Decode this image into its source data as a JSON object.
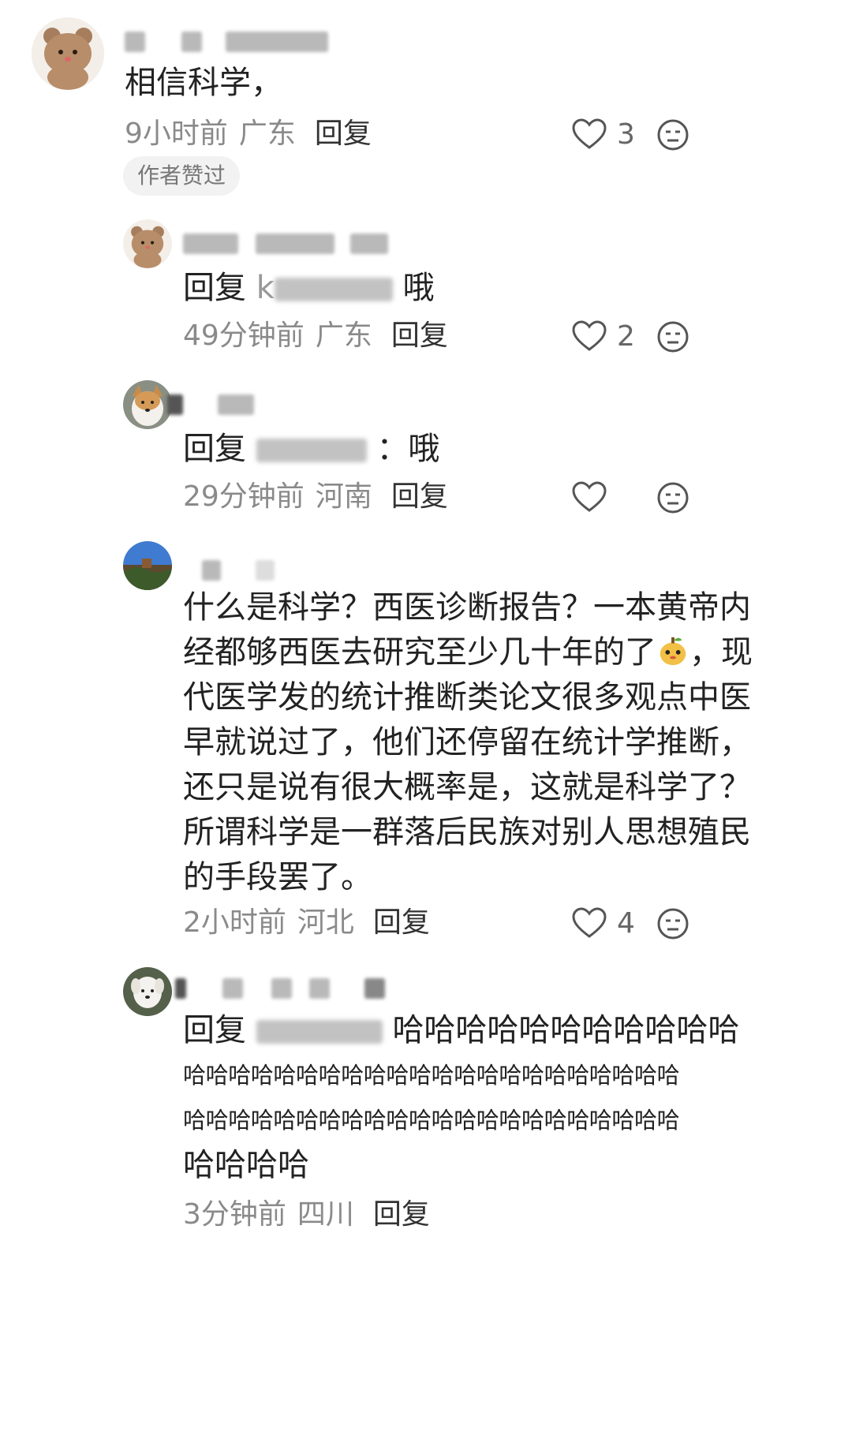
{
  "comments": [
    {
      "avatar": "brown-bear-avatar",
      "text": "相信科学，",
      "time": "9小时前",
      "location": "广东",
      "reply_label": "回复",
      "likes": "3",
      "badge": "作者赞过"
    },
    {
      "avatar": "brown-bear-avatar",
      "reply_prefix": "回复",
      "text_partial_1": "k",
      "text_suffix": "哦",
      "time": "49分钟前",
      "location": "广东",
      "reply_label": "回复",
      "likes": "2"
    },
    {
      "avatar": "dog-avatar",
      "reply_prefix": "回复",
      "text_suffix": "：哦",
      "time": "29分钟前",
      "location": "河南",
      "reply_label": "回复",
      "likes": ""
    },
    {
      "avatar": "landscape-avatar",
      "text_lines": [
        "什么是科学？西医诊断报告？一本黄帝内",
        "经都够西医去研究至少几十年的了",
        "，现",
        "代医学发的统计推断类论文很多观点中医",
        "早就说过了，他们还停留在统计学推断，",
        "还只是说有很大概率是，这就是科学了？",
        "所谓科学是一群落后民族对别人思想殖民",
        "的手段罢了。"
      ],
      "emoji": "pear-face-emoji",
      "time": "2小时前",
      "location": "河北",
      "reply_label": "回复",
      "likes": "4"
    },
    {
      "avatar": "white-dog-avatar",
      "reply_prefix": "回复",
      "text_lines": [
        "哈哈哈哈哈哈哈哈哈哈哈",
        "哈哈哈哈哈哈哈哈哈哈哈哈哈哈哈哈哈哈哈哈哈哈",
        "哈哈哈哈哈哈哈哈哈哈哈哈哈哈哈哈哈哈哈哈哈哈",
        "哈哈哈哈"
      ],
      "time": "3分钟前",
      "location": "四川",
      "reply_label": "回复"
    }
  ],
  "colors": {
    "text": "#222222",
    "meta": "#8a8a8a",
    "badge_bg": "#f2f2f2"
  }
}
